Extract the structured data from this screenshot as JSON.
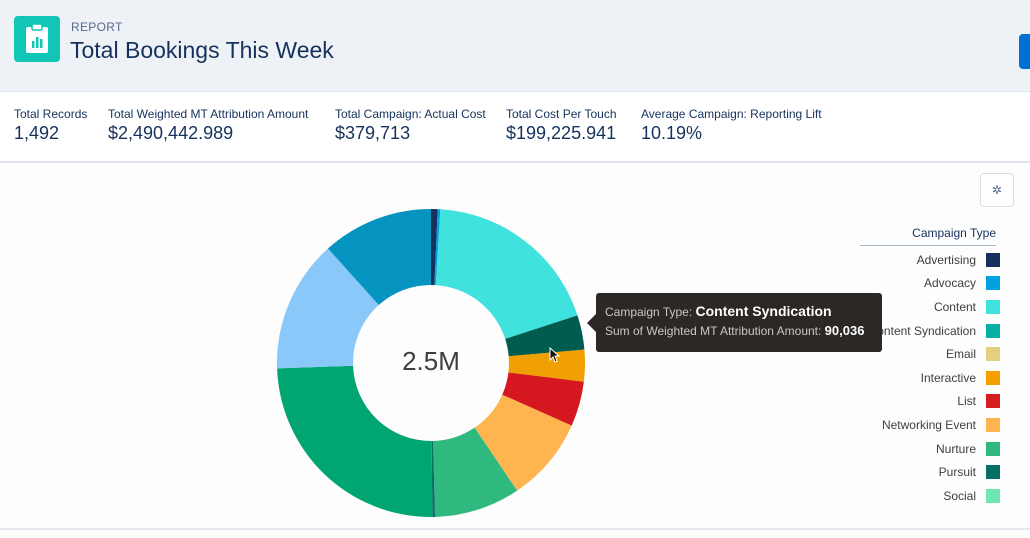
{
  "header": {
    "eyebrow": "REPORT",
    "title": "Total Bookings This Week",
    "icon": "report-clipboard-chart-icon",
    "icon_color": "#11c6b4",
    "action_button_color": "#0070d2"
  },
  "summary": [
    {
      "label": "Total Records",
      "value": "1,492"
    },
    {
      "label": "Total Weighted MT Attribution Amount",
      "value": "$2,490,442.989"
    },
    {
      "label": "Total Campaign: Actual Cost",
      "value": "$379,713"
    },
    {
      "label": "Total Cost Per Touch",
      "value": "$199,225.941"
    },
    {
      "label": "Average Campaign: Reporting Lift",
      "value": "10.19%"
    }
  ],
  "chart_settings": {
    "icon": "gear-icon"
  },
  "tooltip": {
    "key1": "Campaign Type: ",
    "val1": "Content Syndication",
    "key2": "Sum of Weighted MT Attribution Amount: ",
    "val2": "90,036"
  },
  "chart_data": {
    "type": "pie",
    "subtype": "donut",
    "center_label": "2.5M",
    "legend_title": "Campaign Type",
    "legend_position": "right",
    "measure": "Sum of Weighted MT Attribution Amount",
    "total": 2490443,
    "legend": [
      {
        "name": "Advertising",
        "color": "#16325c"
      },
      {
        "name": "Advocacy",
        "color": "#00a1e0"
      },
      {
        "name": "Content",
        "color": "#3fe2dc"
      },
      {
        "name": "Content Syndication",
        "color": "#04b0a4"
      },
      {
        "name": "Email",
        "color": "#e3cf7d"
      },
      {
        "name": "Interactive",
        "color": "#f4a000"
      },
      {
        "name": "List",
        "color": "#d61d1f"
      },
      {
        "name": "Networking Event",
        "color": "#ffb54f"
      },
      {
        "name": "Nurture",
        "color": "#2fb97f"
      },
      {
        "name": "Pursuit",
        "color": "#046f65"
      },
      {
        "name": "Social",
        "color": "#6ee7b0"
      }
    ],
    "slices": [
      {
        "name": "Advertising",
        "value": 17295,
        "color": "#16325c"
      },
      {
        "name": "Advocacy",
        "value": 6918,
        "color": "#00a1e0"
      },
      {
        "name": "Content",
        "value": 473876,
        "color": "#3fe2dc"
      },
      {
        "name": "Content Syndication",
        "value": 90036,
        "color": "#005c4f",
        "highlighted": true
      },
      {
        "name": "Interactive",
        "value": 83015,
        "color": "#f0a000"
      },
      {
        "name": "List",
        "value": 117604,
        "color": "#d5171f"
      },
      {
        "name": "Networking Event",
        "value": 221373,
        "color": "#ffb54f"
      },
      {
        "name": "Nurture",
        "value": 224832,
        "color": "#2fb97f"
      },
      {
        "name": "Pursuit",
        "value": 6918,
        "color": "#046f65"
      },
      {
        "name": "",
        "value": 612234,
        "color": "#00a572"
      },
      {
        "name": "",
        "value": 345895,
        "color": "#8ac8fa"
      },
      {
        "name": "",
        "value": 290552,
        "color": "#0593c0"
      }
    ]
  }
}
